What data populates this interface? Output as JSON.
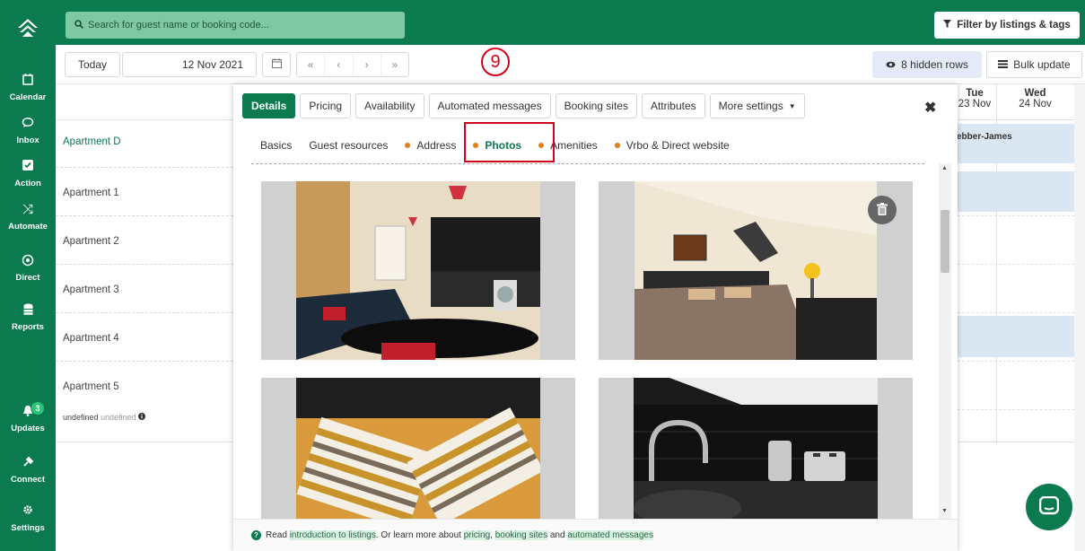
{
  "sidebar": {
    "items": [
      {
        "label": "Calendar",
        "icon": "calendar-icon",
        "glyph": "▭"
      },
      {
        "label": "Inbox",
        "icon": "chat-icon",
        "glyph": "◌"
      },
      {
        "label": "Action",
        "icon": "checkbox-icon",
        "glyph": "☑"
      },
      {
        "label": "Automate",
        "icon": "shuffle-icon",
        "glyph": "⤨"
      },
      {
        "label": "Direct",
        "icon": "direct-icon",
        "glyph": "◎"
      },
      {
        "label": "Reports",
        "icon": "database-icon",
        "glyph": "≣"
      },
      {
        "label": "Updates",
        "icon": "bell-icon",
        "glyph": "▲",
        "badge": "3"
      },
      {
        "label": "Connect",
        "icon": "plug-icon",
        "glyph": "✎"
      },
      {
        "label": "Settings",
        "icon": "gear-icon",
        "glyph": "✱"
      }
    ]
  },
  "topbar": {
    "search_placeholder": "Search for guest name or booking code...",
    "filter_label": "Filter by listings & tags"
  },
  "toolbar": {
    "today_label": "Today",
    "date_value": "12 Nov 2021",
    "nav": [
      "«",
      "‹",
      "›",
      "»"
    ],
    "step_marker": "9",
    "hidden_rows_label": "8 hidden rows",
    "bulk_update_label": "Bulk update"
  },
  "calendar": {
    "rows": [
      {
        "label": "Apartment D",
        "color": "#0c7a4f"
      },
      {
        "label": "Apartment 1"
      },
      {
        "label": "Apartment 2"
      },
      {
        "label": "Apartment 3"
      },
      {
        "label": "Apartment 4"
      },
      {
        "label": "Apartment 5"
      }
    ],
    "undefined_label": "undefined",
    "undefined_label_2": "undefined",
    "days": [
      {
        "weekday": "Tue",
        "date": "23 Nov"
      },
      {
        "weekday": "Wed",
        "date": "24 Nov"
      }
    ],
    "booking_guest": "ebber-James"
  },
  "modal": {
    "tabs": [
      "Details",
      "Pricing",
      "Availability",
      "Automated messages",
      "Booking sites",
      "Attributes",
      "More settings"
    ],
    "active_tab": "Details",
    "subtabs": [
      {
        "label": "Basics",
        "dot": false
      },
      {
        "label": "Guest resources",
        "dot": false
      },
      {
        "label": "Address",
        "dot": true
      },
      {
        "label": "Photos",
        "dot": true
      },
      {
        "label": "Amenities",
        "dot": true
      },
      {
        "label": "Vrbo & Direct website",
        "dot": true
      }
    ],
    "photos": [
      {
        "alt": "living-room-kitchen-photo"
      },
      {
        "alt": "bedroom-photo"
      },
      {
        "alt": "pillows-photo"
      },
      {
        "alt": "kitchen-counter-photo"
      }
    ],
    "footer": {
      "prefix": "Read",
      "link1": "introduction to listings",
      "middle": ". Or learn more about",
      "link2": "pricing",
      "comma": ",",
      "link3": "booking sites",
      "and": "and",
      "link4": "automated messages"
    }
  },
  "colors": {
    "brand_green": "#0c7a4f",
    "search_bg": "#7fc8a4",
    "highlight_red": "#d0021b",
    "dot_orange": "#e0801d",
    "booking_blue": "#dbe6f3"
  }
}
